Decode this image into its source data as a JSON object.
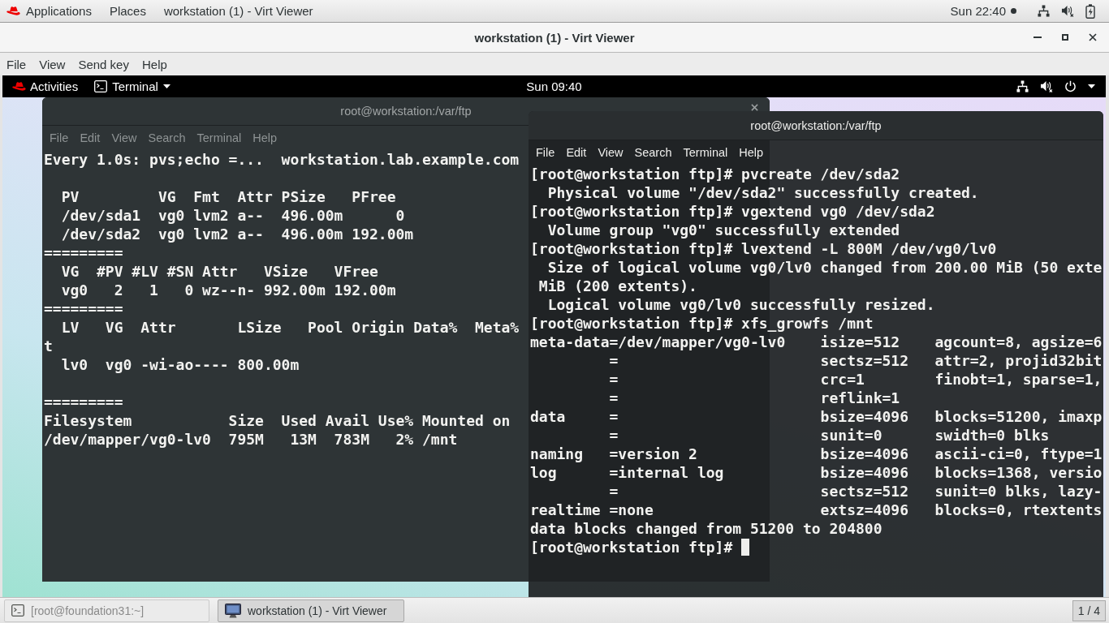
{
  "host_top_bar": {
    "menus": [
      {
        "label": "Applications"
      },
      {
        "label": "Places"
      }
    ],
    "active_app": "workstation (1) - Virt Viewer",
    "clock": "Sun 22:40",
    "notification": true
  },
  "window": {
    "title": "workstation (1) - Virt Viewer",
    "menu": [
      "File",
      "View",
      "Send key",
      "Help"
    ]
  },
  "guest": {
    "top_bar": {
      "activities": "Activities",
      "app_menu": "Terminal",
      "clock": "Sun 09:40"
    },
    "terminals": [
      {
        "title": "root@workstation:/var/ftp",
        "focused": false,
        "menu": [
          "File",
          "Edit",
          "View",
          "Search",
          "Terminal",
          "Help"
        ],
        "output_blocks": [
          [
            "Every 1.0s: pvs;echo =...  workstation.lab.example.com"
          ],
          [
            "  PV         VG  Fmt  Attr PSize   PFree",
            "  /dev/sda1  vg0 lvm2 a--  496.00m      0",
            "  /dev/sda2  vg0 lvm2 a--  496.00m 192.00m",
            "=========",
            "  VG  #PV #LV #SN Attr   VSize   VFree",
            "  vg0   2   1   0 wz--n- 992.00m 192.00m",
            "=========",
            "  LV   VG  Attr       LSize   Pool Origin Data%  Meta%",
            "t",
            "  lv0  vg0 -wi-ao---- 800.00m"
          ],
          [
            "=========",
            "Filesystem           Size  Used Avail Use% Mounted on",
            "/dev/mapper/vg0-lv0  795M   13M  783M   2% /mnt"
          ]
        ]
      },
      {
        "title": "root@workstation:/var/ftp",
        "focused": true,
        "menu": [
          "File",
          "Edit",
          "View",
          "Search",
          "Terminal",
          "Help"
        ],
        "output_blocks": [
          [
            "[root@workstation ftp]# pvcreate /dev/sda2",
            "  Physical volume \"/dev/sda2\" successfully created.",
            "[root@workstation ftp]# vgextend vg0 /dev/sda2",
            "  Volume group \"vg0\" successfully extended",
            "[root@workstation ftp]# lvextend -L 800M /dev/vg0/lv0",
            "  Size of logical volume vg0/lv0 changed from 200.00 MiB (50 exte",
            " MiB (200 extents).",
            "  Logical volume vg0/lv0 successfully resized.",
            "[root@workstation ftp]# xfs_growfs /mnt",
            "meta-data=/dev/mapper/vg0-lv0    isize=512    agcount=8, agsize=6",
            "         =                       sectsz=512   attr=2, projid32bit",
            "         =                       crc=1        finobt=1, sparse=1,",
            "         =                       reflink=1",
            "data     =                       bsize=4096   blocks=51200, imaxp",
            "         =                       sunit=0      swidth=0 blks",
            "naming   =version 2              bsize=4096   ascii-ci=0, ftype=1",
            "log      =internal log           bsize=4096   blocks=1368, versio",
            "         =                       sectsz=512   sunit=0 blks, lazy-",
            "realtime =none                   extsz=4096   blocks=0, rtextents",
            "data blocks changed from 51200 to 204800",
            "[root@workstation ftp]#"
          ]
        ],
        "cursor": true
      }
    ]
  },
  "taskbar": {
    "tasks": [
      {
        "label": "[root@foundation31:~]",
        "kind": "terminal",
        "selected": false
      },
      {
        "label": "workstation (1) - Virt Viewer",
        "kind": "viewer",
        "selected": true
      }
    ],
    "workspace": "1 / 4"
  }
}
